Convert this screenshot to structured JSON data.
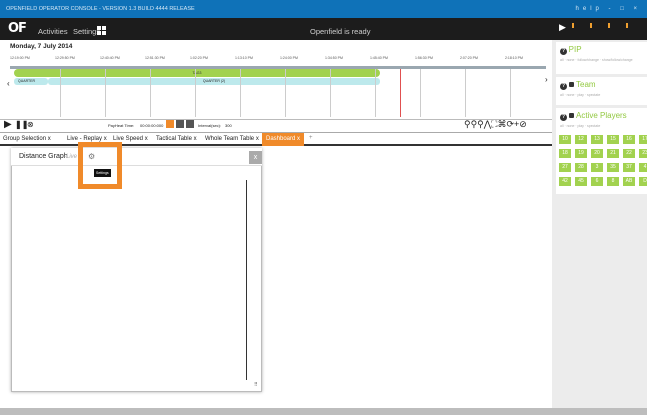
{
  "titlebar": {
    "text": "OPENFIELD OPERATOR CONSOLE - VERSION 1.3 BUILD 4444 RELEASE",
    "win_controls": "help - □ ×"
  },
  "header": {
    "logo": "OF",
    "menu": [
      "Activities",
      "Settings"
    ],
    "status": "Openfield is ready"
  },
  "timeline": {
    "date": "Monday, 7 July 2014",
    "times": [
      "12:19:00 PM",
      "12:29:50 PM",
      "12:40:40 PM",
      "12:51:30 PM",
      "1:02:20 PM",
      "1:13:10 PM",
      "1:24:00 PM",
      "1:34:50 PM",
      "1:45:40 PM",
      "1:56:30 PM",
      "2:07:20 PM",
      "2:18:10 PM"
    ],
    "bar_green": "TAG3",
    "bar_q1": "QUARTER",
    "bar_q2": "QUARTER (2)",
    "nav_left": "‹",
    "nav_right": "›"
  },
  "controls": {
    "play": "▶",
    "pause": "❚❚",
    "stop": "⊗",
    "payheat_label": "PayHeat Time:",
    "payheat_val": "00:00:00:000",
    "interval_label": "Interval(sec):",
    "interval_val": "300",
    "zoom_icons": "⚲⚲⚲⋀⛶⌘⟳+⊘"
  },
  "tabs": [
    "Group Selection",
    "Live - Replay",
    "Live Speed",
    "Tactical Table",
    "Whole Team Table"
  ],
  "tab_close": "x",
  "active_tab": "Dashboard  x",
  "add_tab": "+",
  "widget": {
    "title": "Distance Graph",
    "live": "-Live",
    "close": "x",
    "gear": "⚙",
    "tooltip": "Settings"
  },
  "sidebar": {
    "play": "▶",
    "pip": {
      "title": "PIP",
      "sub": "all · none · follow/change · show/follow/change"
    },
    "team": {
      "title": "Team",
      "sub": "all · none · play · spectate"
    },
    "active": {
      "title": "Active Players",
      "sub": "all · none · play · spectate"
    },
    "players": [
      "10",
      "12",
      "13",
      "15",
      "16",
      "17",
      "18",
      "19",
      "20",
      "21",
      "22",
      "23",
      "27",
      "28",
      "3",
      "35",
      "37",
      "4",
      "42",
      "45",
      "6",
      "8",
      "AB",
      "D"
    ]
  },
  "colors": {
    "accent": "#f08a2a",
    "brand_blue": "#0f72b8",
    "green": "#a2d24f"
  }
}
